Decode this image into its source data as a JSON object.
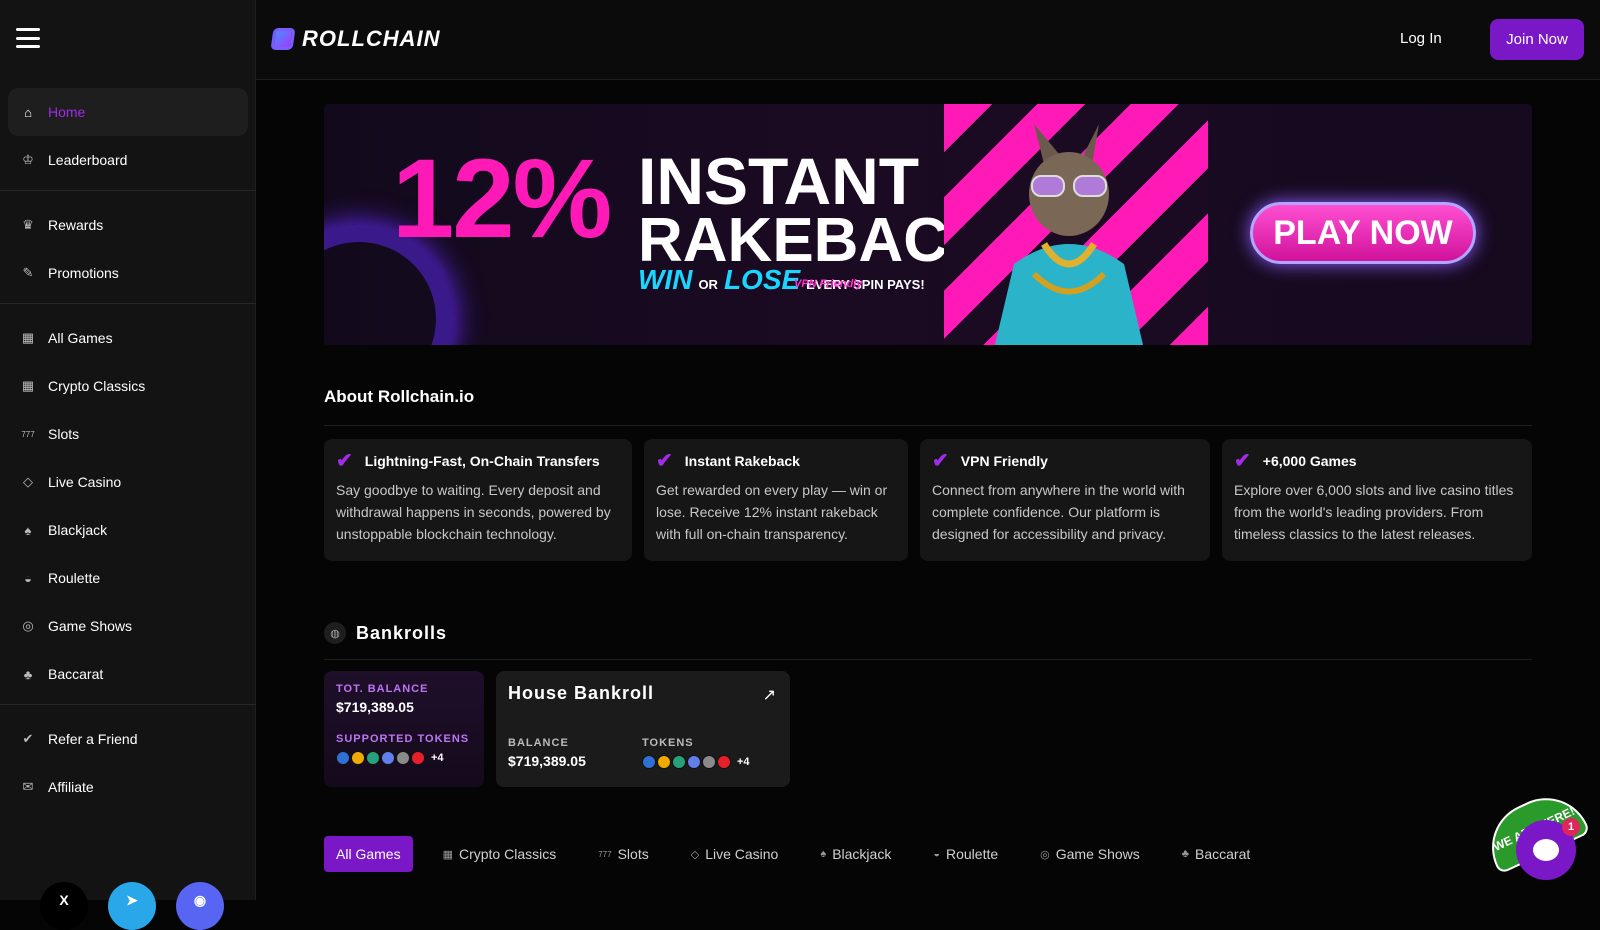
{
  "brand": {
    "name": "ROLLCHAIN"
  },
  "header": {
    "login_label": "Log In",
    "join_label": "Join Now"
  },
  "sidebar": {
    "groups": [
      [
        {
          "label": "Home",
          "icon": "home-icon",
          "active": true
        },
        {
          "label": "Leaderboard",
          "icon": "trophy-icon"
        }
      ],
      [
        {
          "label": "Rewards",
          "icon": "crown-icon"
        },
        {
          "label": "Promotions",
          "icon": "megaphone-icon"
        }
      ],
      [
        {
          "label": "All Games",
          "icon": "grid-icon"
        },
        {
          "label": "Crypto Classics",
          "icon": "grid-icon"
        },
        {
          "label": "Slots",
          "icon": "slots-icon"
        },
        {
          "label": "Live Casino",
          "icon": "diamond-icon"
        },
        {
          "label": "Blackjack",
          "icon": "spade-icon"
        },
        {
          "label": "Roulette",
          "icon": "roulette-icon"
        },
        {
          "label": "Game Shows",
          "icon": "gameshow-icon"
        },
        {
          "label": "Baccarat",
          "icon": "cards-icon"
        }
      ],
      [
        {
          "label": "Refer a Friend",
          "icon": "thumbs-up-icon"
        },
        {
          "label": "Affiliate",
          "icon": "affiliate-icon"
        }
      ]
    ],
    "socials": [
      {
        "name": "x-icon",
        "glyph": "X",
        "color": "#000000"
      },
      {
        "name": "telegram-icon",
        "glyph": "➤",
        "color": "#2aa7e8"
      },
      {
        "name": "discord-icon",
        "glyph": "◉",
        "color": "#5865f2"
      }
    ]
  },
  "banner": {
    "percent": "12%",
    "line1": "INSTANT",
    "line2": "RAKEBACK",
    "win": "WIN",
    "or": "OR",
    "lose": "LOSE",
    "spin": "EVERY SPIN PAYS!",
    "vpn": "VPN Friendly",
    "cta": "PLAY NOW"
  },
  "about": {
    "title": "About Rollchain.io",
    "cards": [
      {
        "title": "Lightning-Fast, On-Chain Transfers",
        "desc": "Say goodbye to waiting. Every deposit and withdrawal happens in seconds, powered by unstoppable blockchain technology."
      },
      {
        "title": "Instant Rakeback",
        "desc": "Get rewarded on every play — win or lose. Receive 12% instant rakeback with full on-chain transparency."
      },
      {
        "title": "VPN Friendly",
        "desc": "Connect from anywhere in the world with complete confidence. Our platform is designed for accessibility and privacy."
      },
      {
        "title": "+6,000 Games",
        "desc": "Explore over 6,000 slots and live casino titles from the world's leading providers. From timeless classics to the latest releases."
      }
    ]
  },
  "bankrolls": {
    "title": "Bankrolls",
    "total": {
      "balance_label": "TOT. BALANCE",
      "balance": "$719,389.05",
      "tokens_label": "SUPPORTED TOKENS",
      "more": "+4"
    },
    "house": {
      "title": "House Bankroll",
      "balance_label": "BALANCE",
      "balance": "$719,389.05",
      "tokens_label": "TOKENS",
      "more": "+4"
    },
    "token_colors": [
      "#2f6fd6",
      "#f2a900",
      "#26a17b",
      "#627eea",
      "#8a8a8a",
      "#e5202b"
    ]
  },
  "game_tabs": [
    {
      "label": "All Games",
      "active": true
    },
    {
      "label": "Crypto Classics",
      "icon": "grid-icon"
    },
    {
      "label": "Slots",
      "icon": "slots-icon"
    },
    {
      "label": "Live Casino",
      "icon": "diamond-icon"
    },
    {
      "label": "Blackjack",
      "icon": "spade-icon"
    },
    {
      "label": "Roulette",
      "icon": "roulette-icon"
    },
    {
      "label": "Game Shows",
      "icon": "gameshow-icon"
    },
    {
      "label": "Baccarat",
      "icon": "cards-icon"
    }
  ],
  "chat": {
    "badge_text": "WE ARE HERE!",
    "unread": "1"
  },
  "colors": {
    "accent": "#7a17c7",
    "accent_text": "#a12be8",
    "banner_pink": "#ff1ab8",
    "banner_cyan": "#1ad6ff"
  }
}
